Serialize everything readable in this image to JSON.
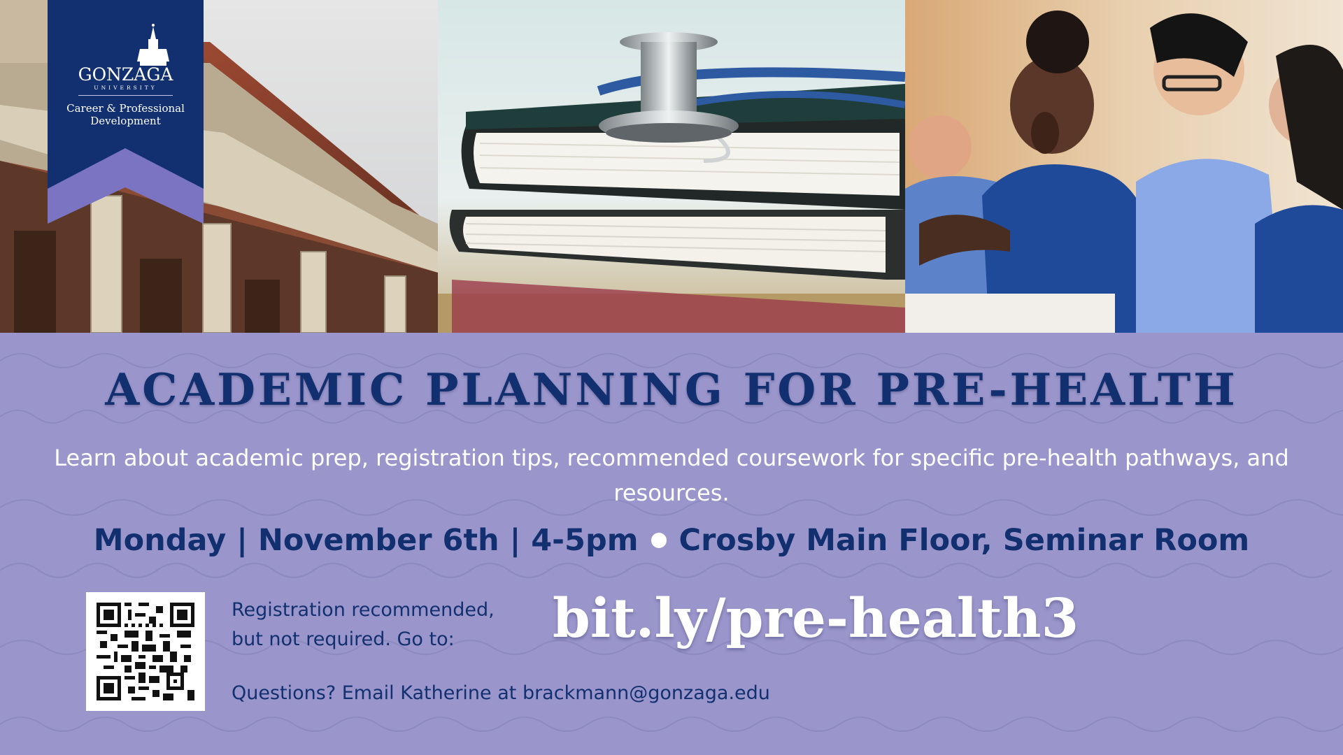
{
  "logo": {
    "wordmark": "GONZAGA",
    "sub": "UNIVERSITY",
    "department": "Career & Professional Development"
  },
  "photos": [
    {
      "name": "dental-school-building-photo"
    },
    {
      "name": "stethoscope-books-photo"
    },
    {
      "name": "students-in-scrubs-photo"
    }
  ],
  "event": {
    "title": "ACADEMIC PLANNING FOR PRE-HEALTH",
    "description": "Learn about academic prep, registration tips, recommended coursework for specific pre-health pathways, and resources.",
    "date_time": "Monday | November 6th | 4-5pm",
    "location": "Crosby Main Floor, Seminar Room",
    "registration_note": "Registration recommended, but not required. Go to:",
    "link": "bit.ly/pre-health3",
    "contact": "Questions? Email Katherine at brackmann@gonzaga.edu"
  },
  "colors": {
    "navy": "#12306f",
    "lavender": "#9a96cc",
    "banner_accent": "#7b74c2"
  }
}
